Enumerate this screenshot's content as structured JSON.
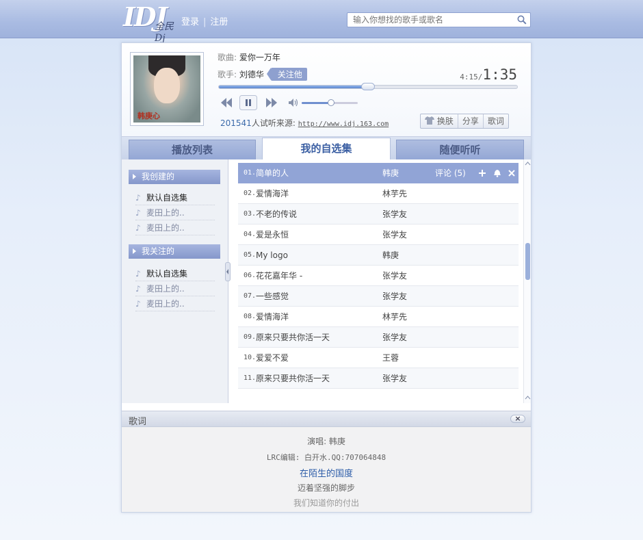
{
  "header": {
    "logo_text": "IDJ",
    "logo_sub": "全民Dj",
    "login": "登录",
    "register": "注册",
    "search_placeholder": "输入你想找的歌手或歌名"
  },
  "player": {
    "song_label": "歌曲:",
    "song_title": "爱你一万年",
    "singer_label": "歌手:",
    "singer_name": "刘德华",
    "follow_label": "关注他",
    "current_time": "4:15/",
    "total_time": "1:35",
    "progress_fraction": 0.5,
    "volume_fraction": 0.52,
    "listen_count": "201541",
    "listen_text": "人试听",
    "source_label": "来源:",
    "source_url": "http://www.idj.163.com",
    "skin_label": "换肤",
    "share_label": "分享",
    "lyrics_label": "歌词",
    "cover_caption": "韩庚心"
  },
  "tabs": [
    {
      "label": "播放列表",
      "active": false
    },
    {
      "label": "我的自选集",
      "active": true
    },
    {
      "label": "随便听听",
      "active": false
    }
  ],
  "sidebar": {
    "created_title": "我创建的",
    "created_items": [
      "默认自选集",
      "麦田上的..",
      "麦田上的.."
    ],
    "followed_title": "我关注的",
    "followed_items": [
      "默认自选集",
      "麦田上的..",
      "麦田上的.."
    ]
  },
  "songs": [
    {
      "num": "01.",
      "title": "简单的人",
      "artist": "韩庚",
      "comment": "评论 (5)"
    },
    {
      "num": "02.",
      "title": "爱情海洋",
      "artist": "林芋先"
    },
    {
      "num": "03.",
      "title": "不老的传说",
      "artist": "张学友"
    },
    {
      "num": "04.",
      "title": "爱是永恒",
      "artist": "张学友"
    },
    {
      "num": "05.",
      "title": "My logo",
      "artist": "韩庚"
    },
    {
      "num": "06.",
      "title": "花花嘉年华 -",
      "artist": "张学友"
    },
    {
      "num": "07.",
      "title": "一些感觉",
      "artist": "张学友"
    },
    {
      "num": "08.",
      "title": "爱情海洋",
      "artist": "林芋先"
    },
    {
      "num": "09.",
      "title": "原来只要共你活一天",
      "artist": "张学友"
    },
    {
      "num": "10.",
      "title": "爱爱不爱",
      "artist": "王蓉"
    },
    {
      "num": "11.",
      "title": "原来只要共你活一天",
      "artist": "张学友"
    }
  ],
  "lyrics": {
    "title": "歌词",
    "close": "×",
    "lines": [
      {
        "text": "演唱: 韩庚",
        "state": "normal"
      },
      {
        "text": "LRC编辑: 白开水.QQ:707064848",
        "state": "normal"
      },
      {
        "text": "在陌生的国度",
        "state": "current"
      },
      {
        "text": "迈着坚强的脚步",
        "state": "normal"
      },
      {
        "text": "我们知道你的付出",
        "state": "dim"
      }
    ]
  },
  "colors": {
    "accent": "#91a4d6",
    "header_bg": "#a9bbe2",
    "current_lyric": "#2c5ca8"
  }
}
